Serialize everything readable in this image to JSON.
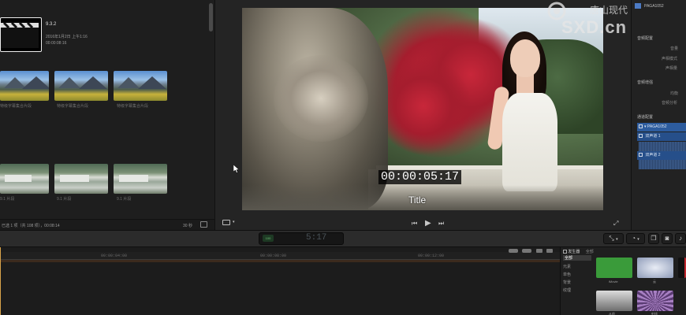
{
  "browser": {
    "event_clip": {
      "title": "9.3.2",
      "date": "2016年1月2日 上午1:16",
      "duration": "00:00:08:16"
    },
    "row1_captions": [
      "特级字幕集合片段",
      "特级字幕集合片段",
      "特级字幕集合片段"
    ],
    "row2_captions": [
      "9.1 片段",
      "9.1 片段",
      "9.1 片段"
    ],
    "footer_text": "已选 1 项（共 108 项），00:08:14",
    "zoom_label": "30 秒"
  },
  "viewer": {
    "timecode": "00:00:05:17",
    "title": "Title",
    "play_icon": "play-icon",
    "prev_icon": "skip-back-icon",
    "next_icon": "skip-forward-icon"
  },
  "inspector": {
    "clip_name": "PAGA1052",
    "sections": {
      "audio_config": "音频配置",
      "volume": "音量",
      "pan_mode": "声相模式",
      "pan_amount": "声相量",
      "audio_enhance": "音频增强",
      "eq": "均衡",
      "analysis": "音频分析",
      "channel_config": "通道配置"
    },
    "roles": [
      "PAGA1052",
      "双声道 1",
      "双声道 2"
    ]
  },
  "toolbar": {
    "dashboard_timecode": "5:17",
    "dashboard_badge": "100"
  },
  "timeline": {
    "ruler_labels": [
      "00:00:04:00",
      "00:00:08:00",
      "00:00:12:00"
    ]
  },
  "generators": {
    "header": "发生器",
    "tab_all": "全部",
    "categories": [
      "全部",
      "元素",
      "单色",
      "背景",
      "纹理"
    ],
    "items": [
      {
        "label": "iMovie",
        "color": "#3a9b3a"
      },
      {
        "label": "云",
        "color": "#b9c3d6"
      },
      {
        "label": "从前",
        "color": "#7a7a7a"
      },
      {
        "label": "射线",
        "color": "#8a6c9b"
      }
    ]
  },
  "watermark": {
    "logo_text": "SXD.cn",
    "cn_text": "唐山现代"
  },
  "colors": {
    "playhead": "#d9a34a",
    "role_blue": "#2d5c9e",
    "dashboard_green": "#6fbf76"
  }
}
